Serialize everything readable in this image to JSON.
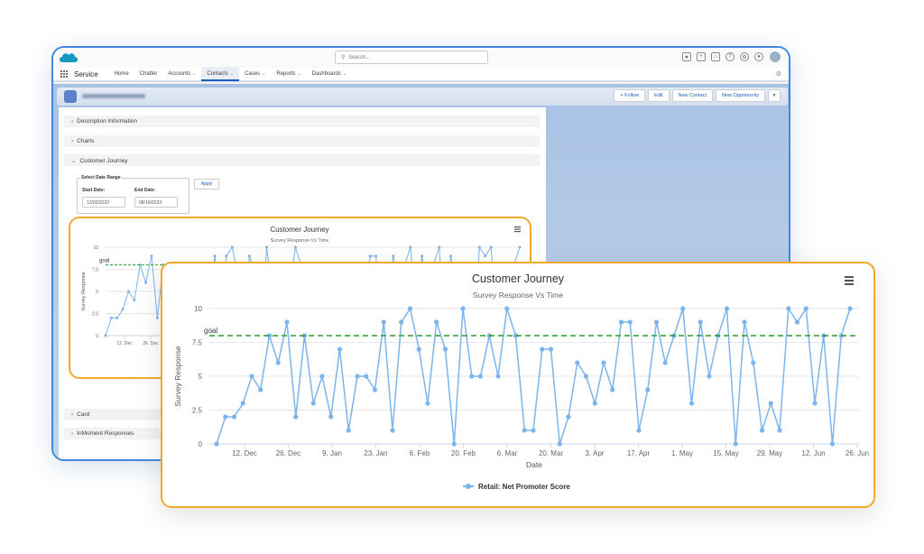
{
  "app": {
    "name": "Service",
    "search_placeholder": "Search...",
    "nav": [
      "Home",
      "Chatter",
      "Accounts",
      "Contacts",
      "Cases",
      "Reports",
      "Dashboards"
    ],
    "nav_dropdowns": [
      false,
      false,
      true,
      true,
      true,
      true,
      true
    ],
    "active_nav": "Contacts",
    "actions": [
      "+ Follow",
      "Edit",
      "New Contact",
      "New Opportunity"
    ]
  },
  "sections": {
    "description": "Description Information",
    "charts": "Charts",
    "journey": "Customer Journey",
    "card": "Card",
    "inmoment": "InMoment Responses"
  },
  "date_range": {
    "legend": "Select Date Range",
    "start_label": "Start Date:",
    "start_value": "12/02/2022",
    "end_label": "End Date:",
    "end_value": "08/16/2023",
    "apply_label": "Apply"
  },
  "colors": {
    "series": "#7cb5ec",
    "goal": "#2a9d2a",
    "border_accent": "#f0a92a",
    "brand_blue": "#1b5fb8"
  },
  "chart_data": [
    {
      "type": "line",
      "title": "Customer Journey",
      "subtitle": "Survey Response Vs Time",
      "ylabel": "Survey Response",
      "y_ticks": [
        "0",
        "2.5",
        "5",
        "7.5",
        "10"
      ],
      "x_ticks": [
        "12. Dec",
        "26. Dec"
      ],
      "ylim": [
        0,
        10
      ],
      "goal": 8,
      "goal_label": "goal",
      "values": [
        0,
        2,
        2,
        3,
        5,
        4,
        8,
        6,
        9,
        2,
        8,
        3,
        5,
        2,
        7,
        1,
        5,
        5,
        4,
        9,
        1,
        9,
        10,
        7,
        3,
        9,
        7,
        0,
        10,
        5,
        5,
        8,
        5,
        10,
        8,
        1,
        1,
        7,
        7,
        0,
        2,
        6,
        5,
        3,
        6,
        4,
        9,
        9,
        1,
        4,
        9,
        6,
        8,
        10,
        3,
        9,
        5,
        8,
        10,
        0,
        9,
        6,
        1,
        3,
        1,
        10,
        9,
        10,
        3,
        8,
        0,
        8,
        10
      ],
      "visible_fraction": 0.16
    },
    {
      "type": "line",
      "title": "Customer Journey",
      "subtitle": "Survey Response Vs Time",
      "xlabel": "Date",
      "ylabel": "Survey Response",
      "x_ticks": [
        "12. Dec",
        "26. Dec",
        "9. Jan",
        "23. Jan",
        "6. Feb",
        "20. Feb",
        "6. Mar",
        "20. Mar",
        "3. Apr",
        "17. Apr",
        "1. May",
        "15. May",
        "29. May",
        "12. Jun",
        "26. Jun"
      ],
      "y_ticks": [
        "0",
        "2.5",
        "5",
        "7.5",
        "10"
      ],
      "ylim": [
        0,
        10
      ],
      "goal": 8,
      "goal_label": "goal",
      "legend": "Retail: Net Promoter Score",
      "legend_position": "bottom",
      "values": [
        0,
        2,
        2,
        3,
        5,
        4,
        8,
        6,
        9,
        2,
        8,
        3,
        5,
        2,
        7,
        1,
        5,
        5,
        4,
        9,
        1,
        9,
        10,
        7,
        3,
        9,
        7,
        0,
        10,
        5,
        5,
        8,
        5,
        10,
        8,
        1,
        1,
        7,
        7,
        0,
        2,
        6,
        5,
        3,
        6,
        4,
        9,
        9,
        1,
        4,
        9,
        6,
        8,
        10,
        3,
        9,
        5,
        8,
        10,
        0,
        9,
        6,
        1,
        3,
        1,
        10,
        9,
        10,
        3,
        8,
        0,
        8,
        10
      ]
    }
  ]
}
